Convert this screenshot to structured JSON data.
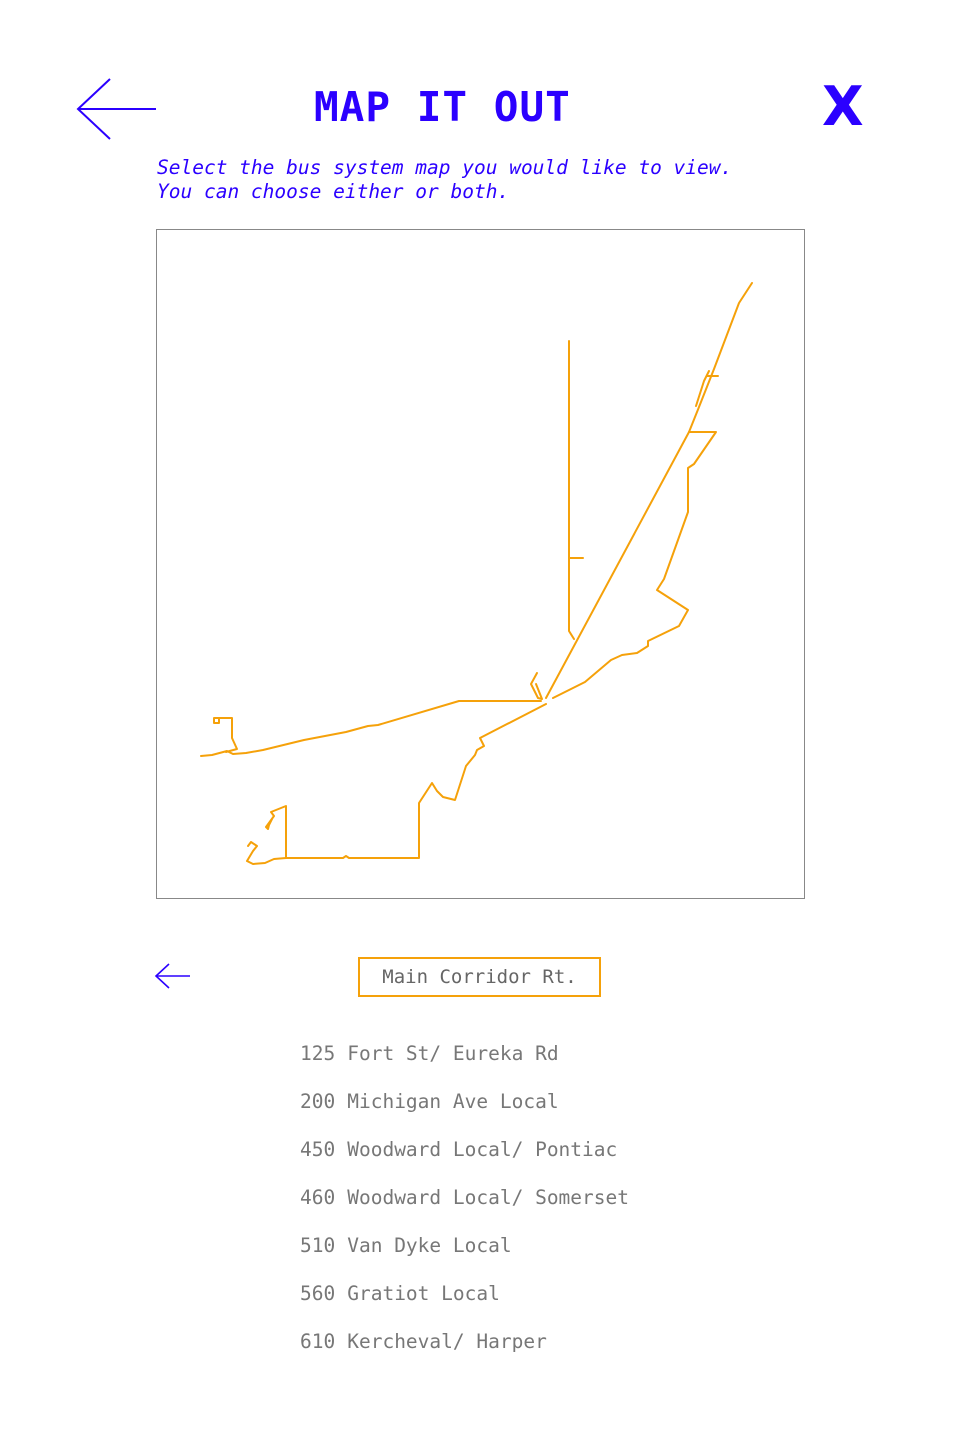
{
  "header": {
    "title": "MAP IT OUT",
    "close_label": "X",
    "back_icon": "arrow-left-icon"
  },
  "instructions": {
    "line1": "Select the bus system map you would like to view.",
    "line2": "You can choose either or both."
  },
  "map": {
    "route_color": "#f5a10a",
    "border_color": "#888888"
  },
  "selector": {
    "label": "Main Corridor Rt.",
    "prev_icon": "arrow-left-icon"
  },
  "routes": [
    {
      "number": "125",
      "name": "Fort St/ Eureka Rd"
    },
    {
      "number": "200",
      "name": "Michigan Ave Local"
    },
    {
      "number": "450",
      "name": "Woodward Local/ Pontiac"
    },
    {
      "number": "460",
      "name": "Woodward Local/ Somerset"
    },
    {
      "number": "510",
      "name": "Van Dyke Local"
    },
    {
      "number": "560",
      "name": "Gratiot Local"
    },
    {
      "number": "610",
      "name": "Kercheval/ Harper"
    }
  ],
  "colors": {
    "accent": "#2b00ff",
    "route": "#f5a10a",
    "text_muted": "#777777"
  }
}
